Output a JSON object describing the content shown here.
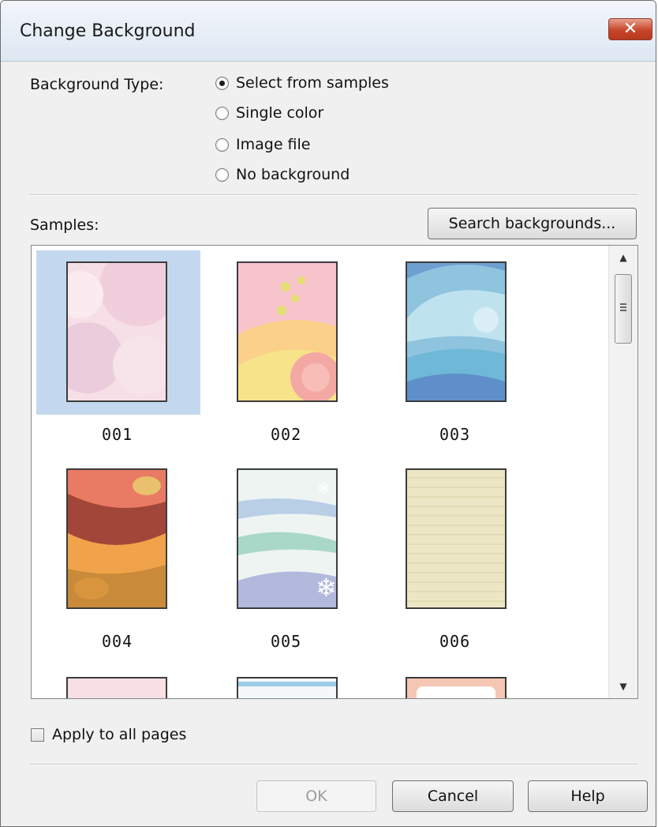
{
  "dialog": {
    "title": "Change Background",
    "close_label": "✕"
  },
  "background_type": {
    "label": "Background Type:",
    "options": [
      {
        "label": "Select from samples",
        "selected": true
      },
      {
        "label": "Single color",
        "selected": false
      },
      {
        "label": "Image file",
        "selected": false
      },
      {
        "label": "No background",
        "selected": false
      }
    ]
  },
  "samples": {
    "label": "Samples:",
    "search_button": "Search backgrounds...",
    "items": [
      {
        "caption": "001",
        "selected": true
      },
      {
        "caption": "002",
        "selected": false
      },
      {
        "caption": "003",
        "selected": false
      },
      {
        "caption": "004",
        "selected": false
      },
      {
        "caption": "005",
        "selected": false
      },
      {
        "caption": "006",
        "selected": false
      }
    ]
  },
  "apply_all": {
    "label": "Apply to all pages",
    "checked": false
  },
  "footer": {
    "ok": "OK",
    "cancel": "Cancel",
    "help": "Help"
  },
  "colors": {
    "selection": "#c3d8ee",
    "close_red": "#c8452a"
  }
}
